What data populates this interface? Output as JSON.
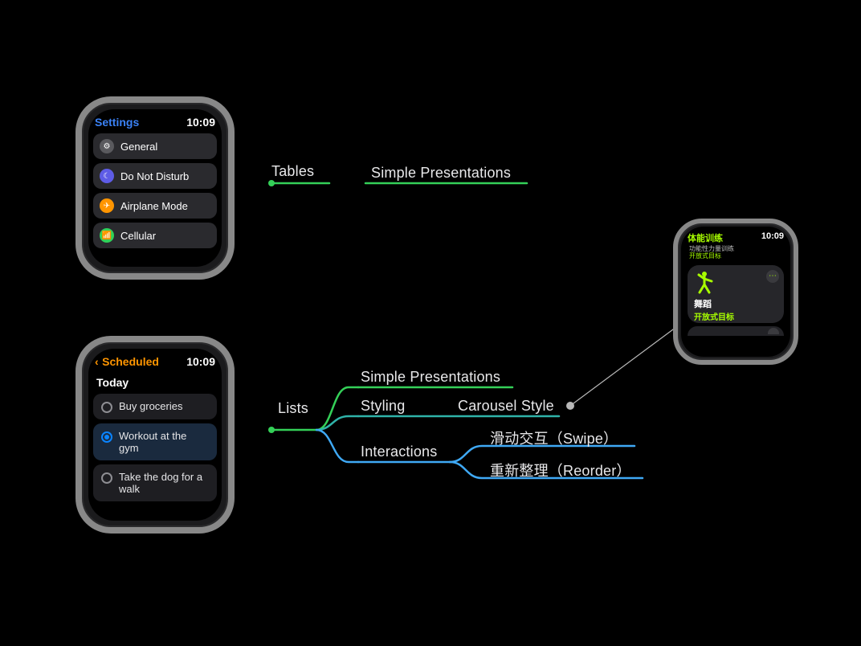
{
  "watch1": {
    "title": "Settings",
    "time": "10:09",
    "items": [
      {
        "label": "General",
        "icon_glyph": "⚙",
        "icon_class": "ic-general"
      },
      {
        "label": "Do Not Disturb",
        "icon_glyph": "☾",
        "icon_class": "ic-dnd"
      },
      {
        "label": "Airplane Mode",
        "icon_glyph": "✈",
        "icon_class": "ic-airplane"
      },
      {
        "label": "Cellular",
        "icon_glyph": "📶",
        "icon_class": "ic-cellular"
      }
    ]
  },
  "watch2": {
    "title": "Scheduled",
    "time": "10:09",
    "section": "Today",
    "items": [
      {
        "label": "Buy groceries",
        "selected": false
      },
      {
        "label": "Workout at the gym",
        "selected": true
      },
      {
        "label": "Take the dog for a walk",
        "selected": false
      }
    ]
  },
  "watch3": {
    "title": "体能训练",
    "time": "10:09",
    "peek_line1": "功能性力量训练",
    "peek_line2": "开放式目标",
    "card_title": "舞蹈",
    "card_sub": "开放式目标"
  },
  "mindmap": {
    "tables": {
      "root": "Tables",
      "child": "Simple Presentations"
    },
    "lists": {
      "root": "Lists",
      "simple": "Simple Presentations",
      "styling": "Styling",
      "carousel": "Carousel Style",
      "interactions": "Interactions",
      "swipe": "滑动交互（Swipe）",
      "reorder": "重新整理（Reorder）"
    }
  }
}
